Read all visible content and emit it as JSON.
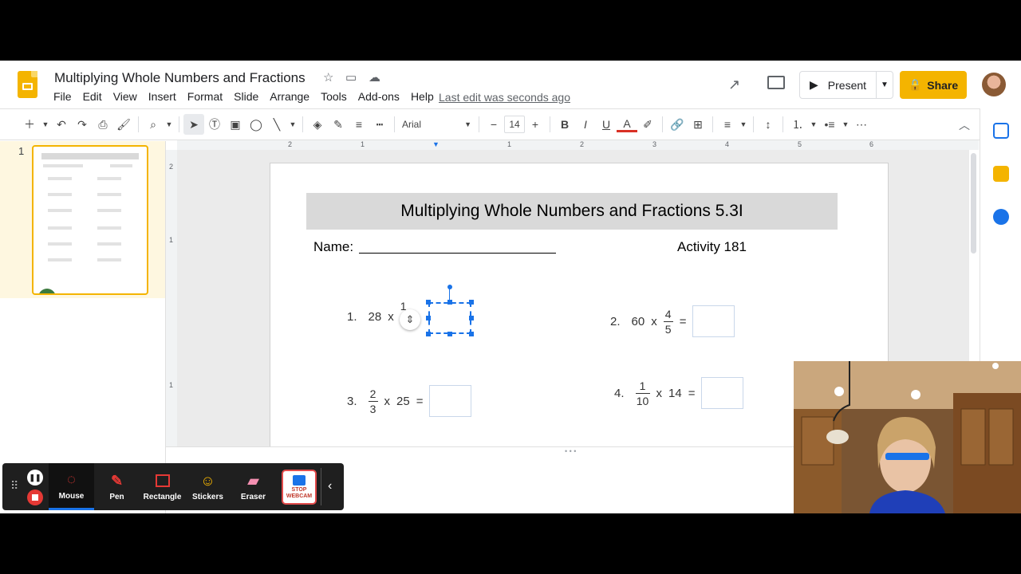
{
  "app": {
    "doc_title": "Multiplying Whole Numbers and Fractions",
    "menu": [
      "File",
      "Edit",
      "View",
      "Insert",
      "Format",
      "Slide",
      "Arrange",
      "Tools",
      "Add-ons",
      "Help"
    ],
    "last_edit": "Last edit was seconds ago",
    "present_label": "Present",
    "share_label": "Share"
  },
  "toolbar": {
    "font": "Arial",
    "font_size": "14"
  },
  "filmstrip": {
    "slide_number": "1"
  },
  "ruler": {
    "h_ticks": [
      "2",
      "1",
      "1",
      "2",
      "3",
      "4",
      "5",
      "6"
    ],
    "v_ticks": [
      "2",
      "1",
      "1"
    ]
  },
  "slide": {
    "title": "Multiplying Whole Numbers and Fractions 5.3I",
    "name_label": "Name:",
    "activity": "Activity 181",
    "problems": [
      {
        "num": "1.",
        "whole": "28",
        "op": "x",
        "frac_num": "1",
        "frac_den": ""
      },
      {
        "num": "2.",
        "whole": "60",
        "op": "x",
        "frac_num": "4",
        "frac_den": "5",
        "eq": "="
      },
      {
        "num": "3.",
        "whole": "25",
        "op": "x",
        "frac_num": "2",
        "frac_den": "3",
        "eq": "="
      },
      {
        "num": "4.",
        "whole": "14",
        "op": "x",
        "frac_num": "1",
        "frac_den": "10",
        "eq": "="
      }
    ]
  },
  "recorder": {
    "tools": [
      {
        "label": "Mouse",
        "icon": "mouse-icon"
      },
      {
        "label": "Pen",
        "icon": "pen-icon"
      },
      {
        "label": "Rectangle",
        "icon": "rectangle-icon"
      },
      {
        "label": "Stickers",
        "icon": "sticker-icon"
      },
      {
        "label": "Eraser",
        "icon": "eraser-icon"
      }
    ],
    "webcam_button": "STOP WEBCAM"
  },
  "colors": {
    "brand_yellow": "#f4b400",
    "selection_blue": "#1a73e8",
    "title_bar_gray": "#d9d9d9"
  }
}
